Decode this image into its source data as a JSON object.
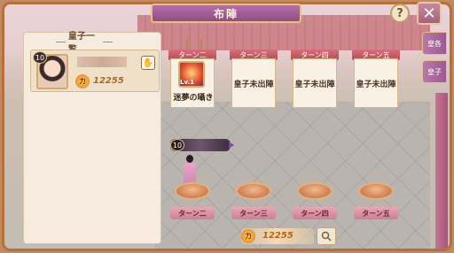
{
  "window": {
    "title": "布陣",
    "help_label": "?",
    "close_label": "✕"
  },
  "side_tabs": [
    {
      "label": "皇各"
    },
    {
      "label": "皇子"
    }
  ],
  "panel": {
    "header": "皇子一覧",
    "prince": {
      "level": "10",
      "power": "12255"
    }
  },
  "turns": [
    {
      "label": "ターン二",
      "body": "",
      "card_name": "迷夢の囁き",
      "card_level": "Lv.1"
    },
    {
      "label": "ターン三",
      "body": "皇子未出陣"
    },
    {
      "label": "ターン四",
      "body": "皇子未出陣"
    },
    {
      "label": "ターン五",
      "body": "皇子未出陣"
    }
  ],
  "player": {
    "level": "10"
  },
  "pedestals": [
    {
      "label": "ターン二"
    },
    {
      "label": "ターン三"
    },
    {
      "label": "ターン四"
    },
    {
      "label": "ターン五"
    }
  ],
  "footer": {
    "total_power": "12255"
  },
  "icons": {
    "power": "power-icon",
    "search": "search-icon",
    "close": "close-icon",
    "help": "help-icon"
  },
  "colors": {
    "title_bar": "#a45d97",
    "turn_banner": "#c65a66",
    "power_text": "#b5621e"
  }
}
